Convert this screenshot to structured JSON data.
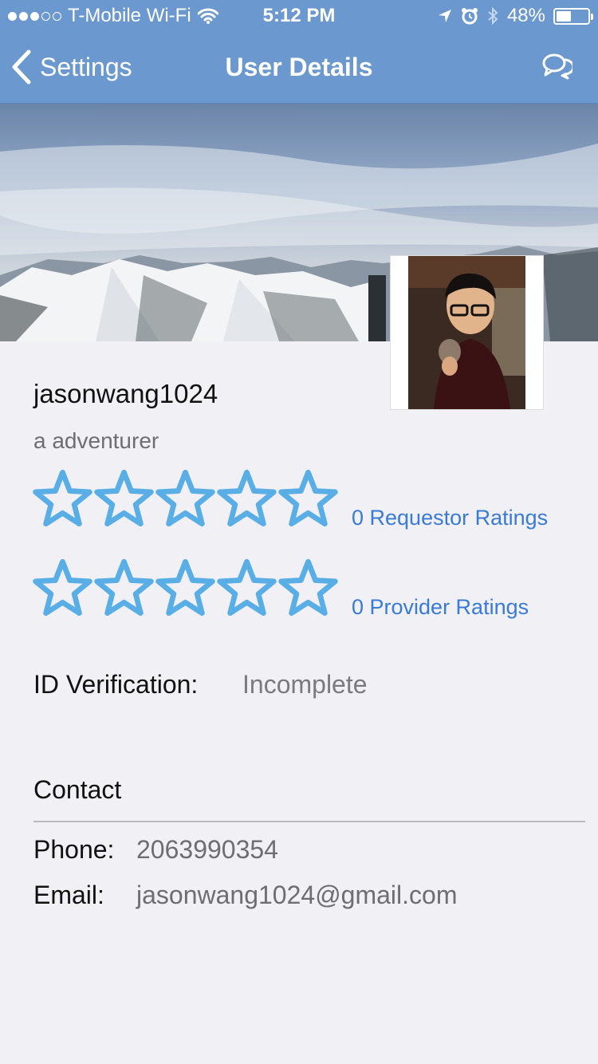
{
  "status_bar": {
    "carrier": "T-Mobile Wi-Fi",
    "time": "5:12 PM",
    "battery": "48%",
    "battery_level": 0.48,
    "signal_bars_filled": 3,
    "signal_bars_total": 5
  },
  "nav": {
    "back_label": "Settings",
    "title": "User Details"
  },
  "profile": {
    "username": "jasonwang1024",
    "tagline": "a adventurer"
  },
  "ratings": {
    "requestor": {
      "stars": 0,
      "max": 5,
      "label": "0 Requestor Ratings"
    },
    "provider": {
      "stars": 0,
      "max": 5,
      "label": "0 Provider Ratings"
    }
  },
  "verification": {
    "label": "ID Verification:",
    "value": "Incomplete"
  },
  "contact": {
    "heading": "Contact",
    "phone_label": "Phone:",
    "phone_value": "2063990354",
    "email_label": "Email:",
    "email_value": "jasonwang1024@gmail.com"
  },
  "colors": {
    "nav_background": "#6a98cf",
    "star_outline": "#5aaee6",
    "link": "#3a7bd5",
    "page_background": "#f1f0f5"
  },
  "icons": {
    "back": "chevron-left-icon",
    "chat": "chat-bubbles-icon",
    "location": "location-arrow-icon",
    "alarm": "alarm-icon",
    "bluetooth": "bluetooth-icon",
    "wifi": "wifi-icon",
    "star": "star-outline-icon"
  }
}
